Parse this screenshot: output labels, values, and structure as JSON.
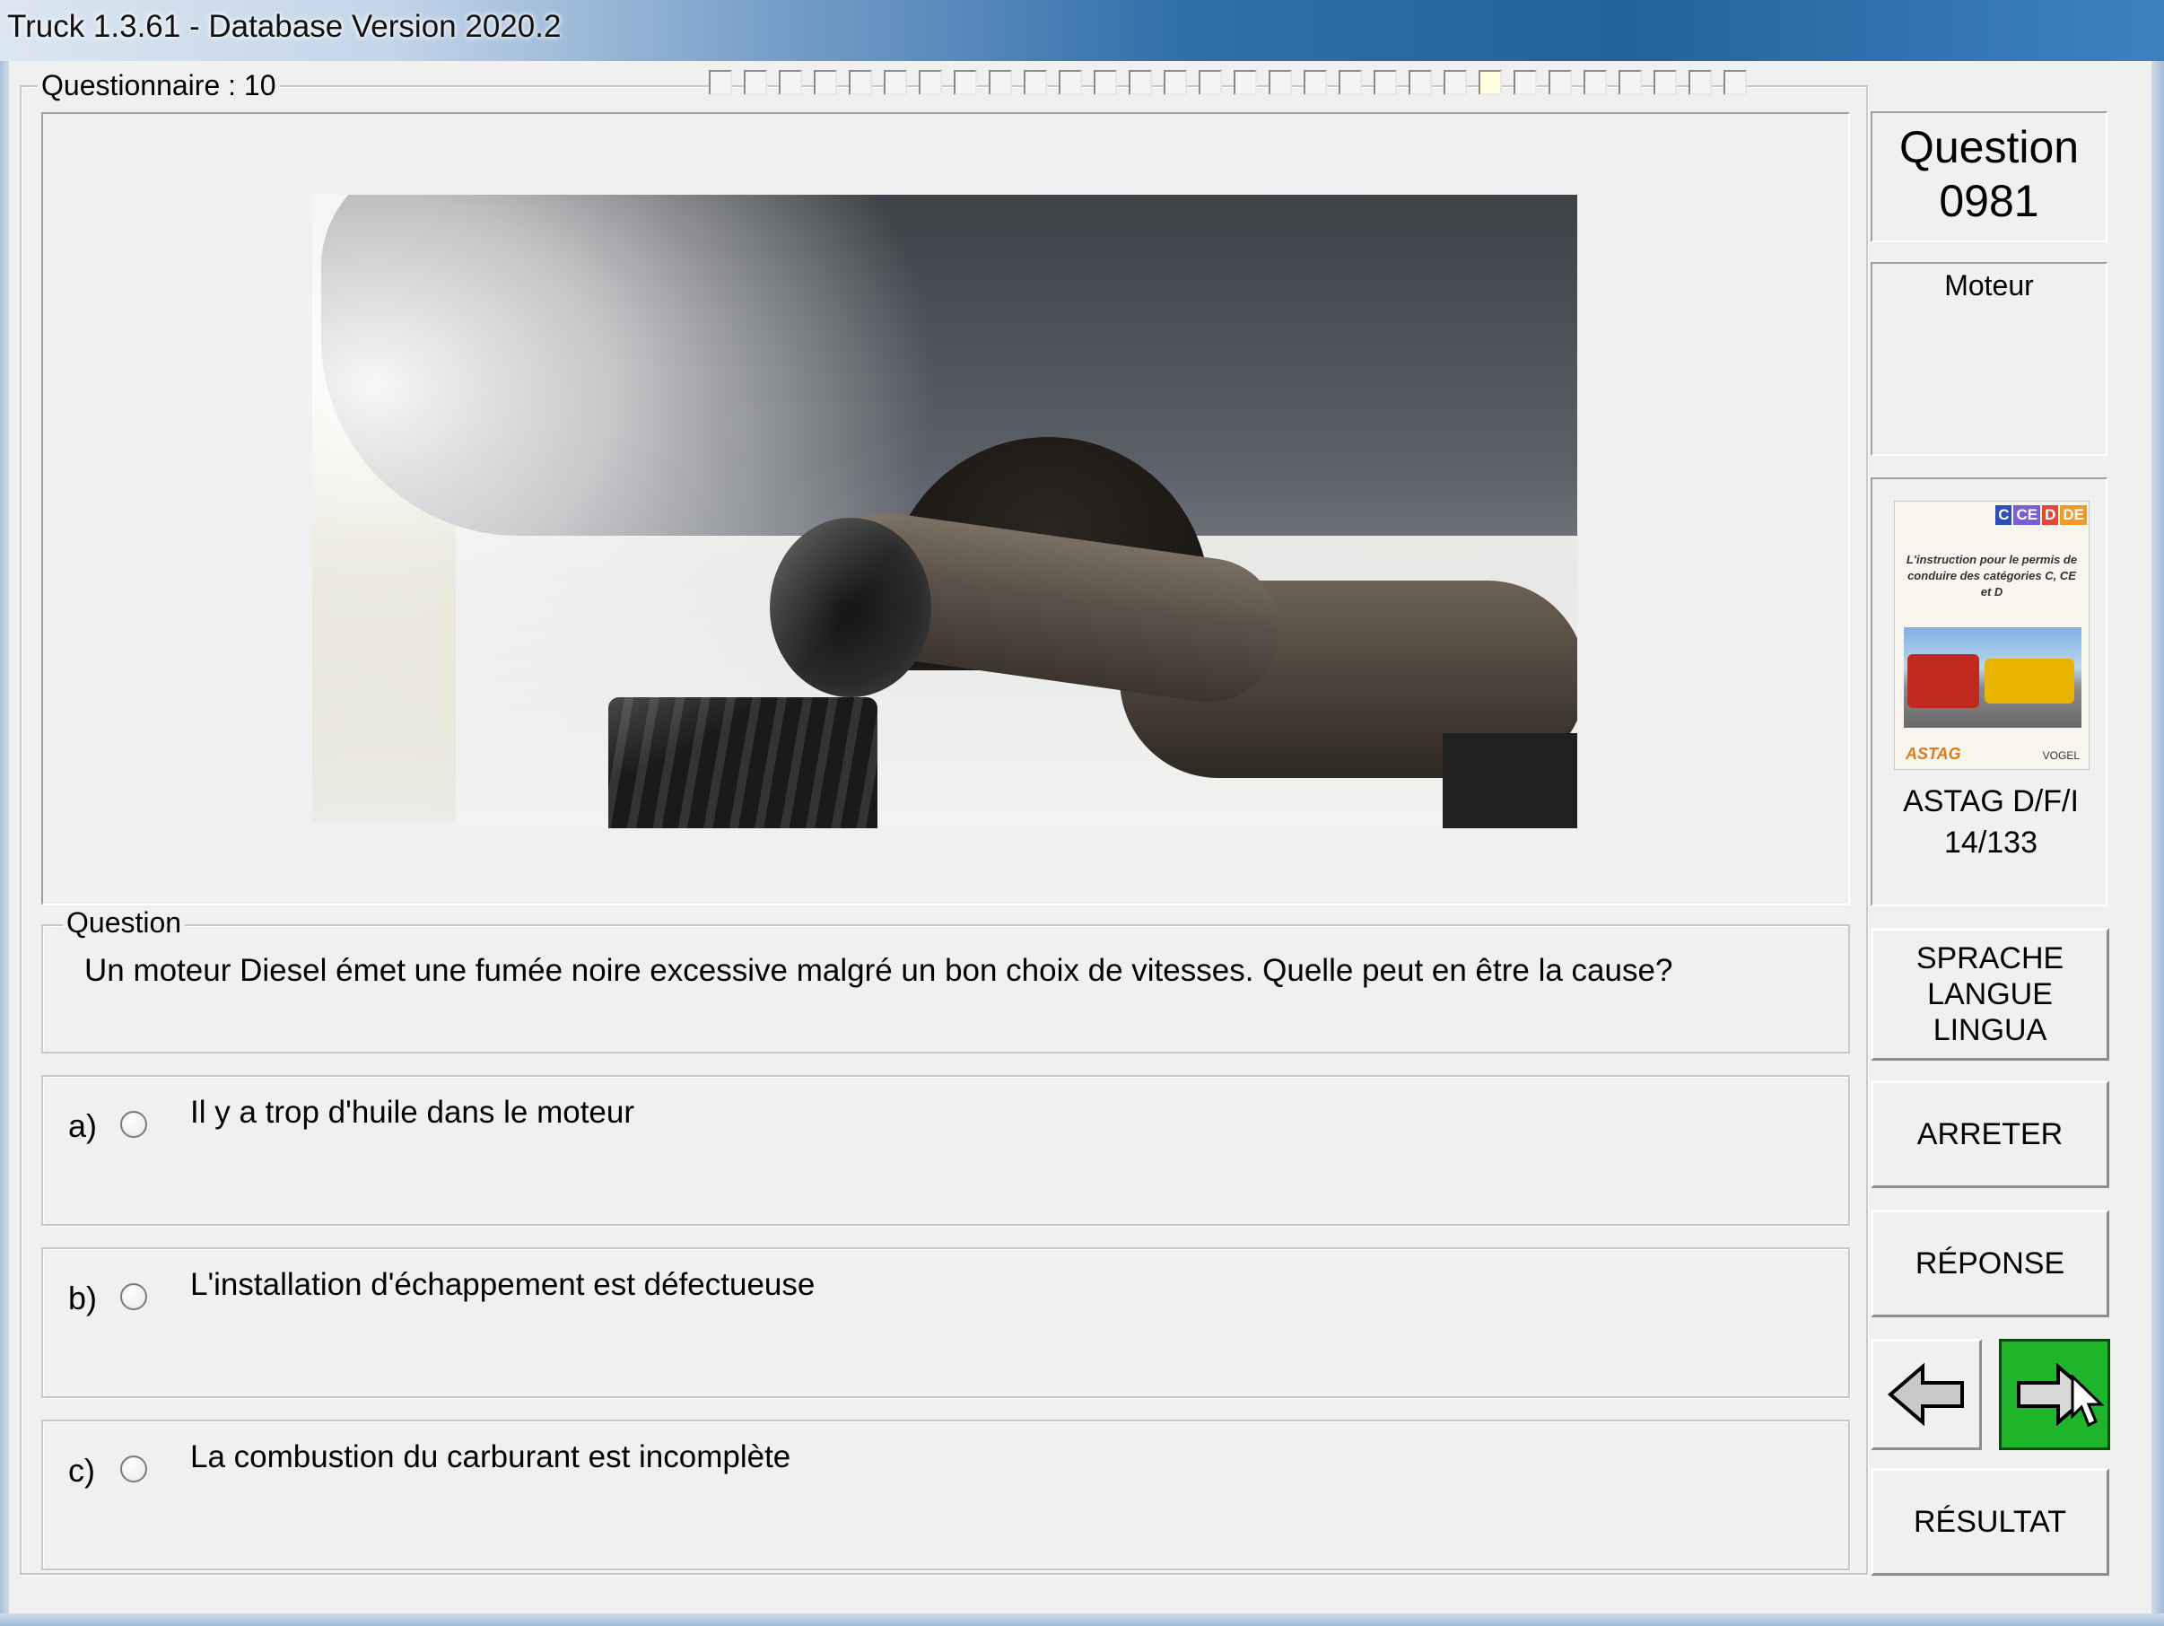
{
  "window": {
    "title": "Truck 1.3.61 - Database Version 2020.2"
  },
  "questionnaire": {
    "label": "Questionnaire : 10",
    "progress_total": 30,
    "progress_current_index": 22
  },
  "question_info": {
    "label": "Question",
    "number": "0981",
    "category": "Moteur"
  },
  "book": {
    "badges": [
      {
        "text": "C",
        "color": "#2d4fb6"
      },
      {
        "text": "CE",
        "color": "#7a5fd0"
      },
      {
        "text": "D",
        "color": "#e2473a"
      },
      {
        "text": "DE",
        "color": "#f09a2a"
      }
    ],
    "cover_text": "L'instruction pour le permis de conduire des catégories C, CE et D",
    "publisher_left": "ASTAG",
    "publisher_right": "VOGEL",
    "name": "ASTAG D/F/I",
    "page": "14/133"
  },
  "buttons": {
    "language": "SPRACHE\nLANGUE\nLINGUA",
    "stop": "ARRETER",
    "answer": "RÉPONSE",
    "result": "RÉSULTAT",
    "prev_icon": "arrow-left-icon",
    "next_icon": "arrow-right-icon"
  },
  "question": {
    "legend": "Question",
    "text": "Un moteur Diesel émet une fumée noire excessive malgré un bon choix de vitesses. Quelle peut en être la cause?"
  },
  "answers": [
    {
      "letter": "a)",
      "text": "Il y a trop d'huile dans le moteur",
      "selected": false
    },
    {
      "letter": "b)",
      "text": "L'installation d'échappement est défectueuse",
      "selected": false
    },
    {
      "letter": "c)",
      "text": "La combustion du carburant est incomplète",
      "selected": false
    }
  ],
  "colors": {
    "next_button_active": "#1fb52a",
    "progress_current": "#ffffe0"
  }
}
